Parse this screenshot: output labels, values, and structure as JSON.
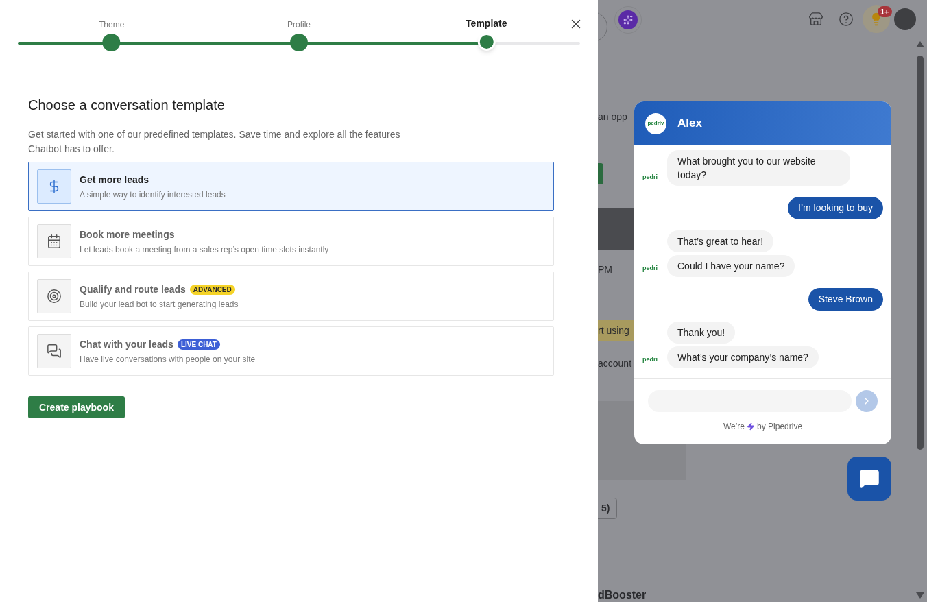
{
  "stepper": {
    "steps": [
      {
        "label": "Theme",
        "selected": false,
        "done": true
      },
      {
        "label": "Profile",
        "selected": false,
        "done": true
      },
      {
        "label": "Template",
        "selected": true,
        "done": false
      }
    ],
    "level": 0.836
  },
  "heading": "Choose a conversation template",
  "intro": "Get started with one of our predefined templates. Save time and explore all the features Chatbot has to offer.",
  "templates": [
    {
      "title": "Get more leads",
      "description": "A simple way to identify interested leads",
      "selected": true
    },
    {
      "title": "Book more meetings",
      "description": "Let leads book a meeting from a sales rep’s open time slots instantly",
      "selected": false
    },
    {
      "title": "Qualify and route leads",
      "badge": {
        "text": "ADVANCED",
        "kind": "advanced"
      },
      "description": "Build your lead bot to start generating leads",
      "selected": false
    },
    {
      "title": "Chat with your leads",
      "badge": {
        "text": "LIVE CHAT",
        "kind": "live"
      },
      "description": "Have live conversations with people on your site",
      "selected": false
    }
  ],
  "create_button": "Create playbook",
  "background_page": {
    "badge": "1+",
    "fragments": [
      {
        "kind": "text",
        "text": "an opp"
      },
      {
        "kind": "text",
        "text": "PM"
      },
      {
        "kind": "highlight",
        "text": "rt using"
      },
      {
        "kind": "text",
        "text": "account"
      },
      {
        "kind": "button",
        "text": "5)"
      },
      {
        "kind": "heading",
        "text": "dBooster"
      }
    ]
  },
  "chat": {
    "avatar_text": "pedriv",
    "name": "Alex",
    "groups": [
      {
        "kind": "bot",
        "avatar_text": "pedri",
        "messages": [
          "What brought you to our website today?"
        ]
      },
      {
        "kind": "user",
        "messages": [
          "I’m looking to buy"
        ]
      },
      {
        "kind": "bot",
        "avatar_text": "pedri",
        "messages": [
          "That’s great to hear!",
          "Could I have your name?"
        ]
      },
      {
        "kind": "user",
        "messages": [
          "Steve Brown"
        ]
      },
      {
        "kind": "bot",
        "avatar_text": "pedri",
        "messages": [
          "Thank you!",
          "What’s your company’s name?"
        ]
      }
    ],
    "footer_before": "We’re",
    "footer_after": "by Pipedrive"
  }
}
